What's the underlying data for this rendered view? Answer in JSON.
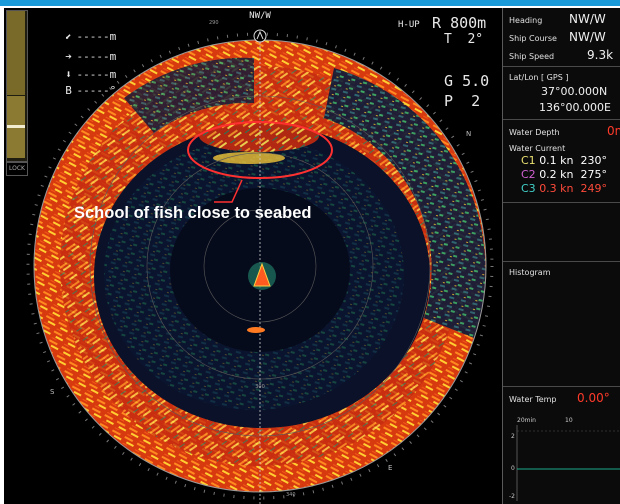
{
  "colors": {
    "accent_bar": "#1a9ad8",
    "highlight_red": "#ff3030",
    "current_c1": "#e8e070",
    "current_c2": "#d060d0",
    "current_c3": "#40d0c8"
  },
  "markers": [
    {
      "icon": "fish-arrow-icon",
      "glyph": "⬋",
      "text": "-----m"
    },
    {
      "icon": "right-arrow-icon",
      "glyph": "➔",
      "text": "-----m"
    },
    {
      "icon": "down-arrow-icon",
      "glyph": "⬇",
      "text": "-----m"
    },
    {
      "icon": "bearing-b-icon",
      "glyph": "B",
      "text": "-----°"
    }
  ],
  "lock_label": "LOCK",
  "direction_label": "NW/W",
  "mode": "H-UP",
  "range": {
    "label": "R",
    "value": "800m"
  },
  "tilt": {
    "label": "T",
    "value": "2°"
  },
  "gain": {
    "label": "G",
    "value": "5.0"
  },
  "pulse": {
    "label": "P",
    "value": "2"
  },
  "annotation": "School of fish close to seabed",
  "compass": {
    "n": "N",
    "e": "E",
    "s": "S"
  },
  "ring_labels": {
    "top": "290",
    "bottom": "300",
    "bottom2": "340"
  },
  "panel": {
    "heading_label": "Heading",
    "heading_value": "NW/W",
    "course_label": "Ship Course",
    "course_value": "NW/W",
    "speed_label": "Ship Speed",
    "speed_value": "9.3k",
    "latlon_label": "Lat/Lon [ GPS ]",
    "lat": "37°00.000N",
    "lon": "136°00.000E",
    "depth_label": "Water Depth",
    "depth_value": "0m",
    "current_label": "Water Current",
    "currents": [
      {
        "tag": "C1",
        "speed": "0.1 kn",
        "dir": "230°"
      },
      {
        "tag": "C2",
        "speed": "0.2 kn",
        "dir": "275°"
      },
      {
        "tag": "C3",
        "speed": "0.3 kn",
        "dir": "249°"
      }
    ],
    "histogram_label": "Histogram",
    "temp_label": "Water Temp",
    "temp_value": "0.00°",
    "temp_axis": {
      "x1": "20min",
      "x2": "10",
      "y1": "2",
      "y2": "0",
      "y3": "-2"
    }
  }
}
